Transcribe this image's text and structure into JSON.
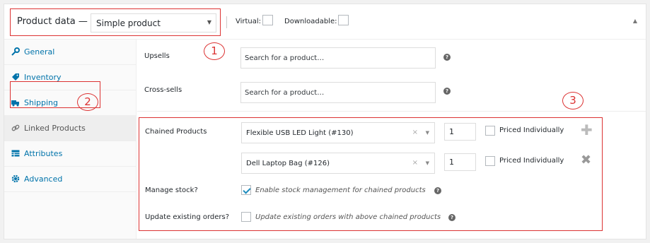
{
  "header": {
    "title": "Product data —",
    "product_type": "Simple product",
    "virtual_label": "Virtual:",
    "downloadable_label": "Downloadable:"
  },
  "annotations": [
    "1",
    "2",
    "3"
  ],
  "sidebar": {
    "items": [
      {
        "label": "General",
        "icon": "wrench-icon"
      },
      {
        "label": "Inventory",
        "icon": "tag-icon"
      },
      {
        "label": "Shipping",
        "icon": "truck-icon"
      },
      {
        "label": "Linked Products",
        "icon": "link-icon"
      },
      {
        "label": "Attributes",
        "icon": "table-icon"
      },
      {
        "label": "Advanced",
        "icon": "gear-icon"
      }
    ],
    "active": "Linked Products"
  },
  "main": {
    "upsells_label": "Upsells",
    "upsells_placeholder": "Search for a product…",
    "crosssells_label": "Cross-sells",
    "crosssells_placeholder": "Search for a product…",
    "chained_label": "Chained Products",
    "chained": [
      {
        "product": "Flexible USB LED Light (#130)",
        "qty": "1",
        "priced_label": "Priced Individually"
      },
      {
        "product": "Dell Laptop Bag (#126)",
        "qty": "1",
        "priced_label": "Priced Individually"
      }
    ],
    "manage_stock_label": "Manage stock?",
    "manage_stock_text": "Enable stock management for chained products",
    "manage_stock_checked": true,
    "update_orders_label": "Update existing orders?",
    "update_orders_text": "Update existing orders with above chained products",
    "update_orders_checked": false
  },
  "colors": {
    "accent": "#0073aa",
    "highlight": "#dc3232"
  }
}
